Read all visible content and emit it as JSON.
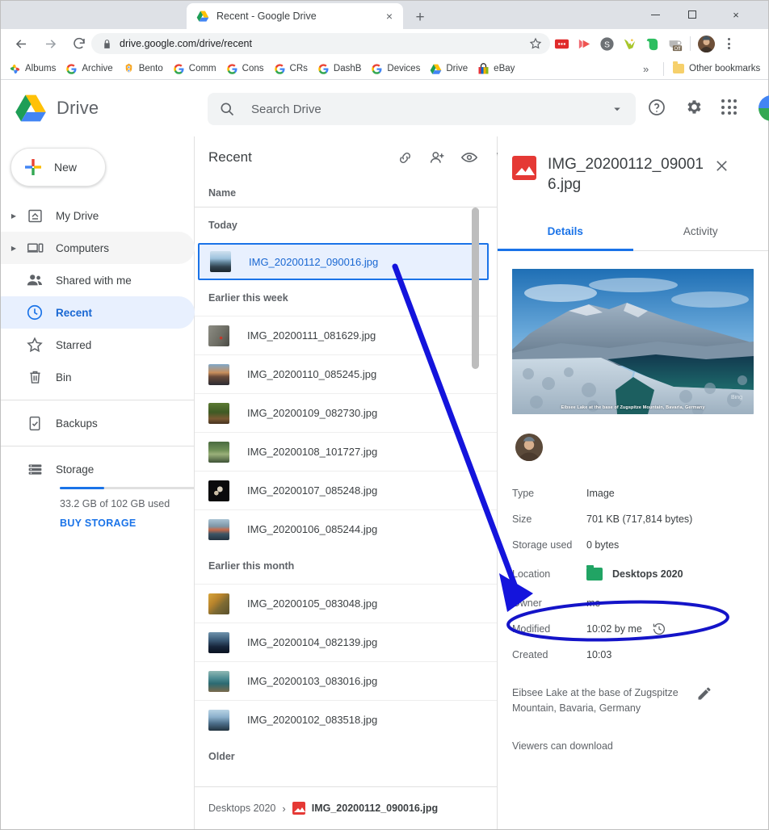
{
  "browser": {
    "tab": {
      "title": "Recent - Google Drive",
      "favicon": "google-drive-icon",
      "close": "×"
    },
    "new_tab_label": "+",
    "window_controls": {
      "minimize": "minimize-icon",
      "maximize": "maximize-icon",
      "close": "×"
    },
    "nav": {
      "back": "←",
      "forward": "→",
      "reload": "↻"
    },
    "omnibox": {
      "url": "drive.google.com/drive/recent",
      "lock": "lock-icon",
      "star": "star-icon"
    },
    "extensions": [
      "red-badge-extension",
      "play-extension",
      "s-circle-extension",
      "bird-extension",
      "evernote-extension",
      "coffee-off-extension"
    ],
    "profile_avatar": "profile-avatar",
    "menu": "three-dot-menu",
    "bookmarks": [
      {
        "label": "Albums",
        "icon": "google-photos-icon"
      },
      {
        "label": "Archive",
        "icon": "google-g-icon"
      },
      {
        "label": "Bento",
        "icon": "bento-icon"
      },
      {
        "label": "Comm",
        "icon": "google-g-icon"
      },
      {
        "label": "Cons",
        "icon": "google-g-icon"
      },
      {
        "label": "CRs",
        "icon": "google-g-icon"
      },
      {
        "label": "DashB",
        "icon": "google-g-icon"
      },
      {
        "label": "Devices",
        "icon": "google-g-icon"
      },
      {
        "label": "Drive",
        "icon": "google-drive-icon"
      },
      {
        "label": "eBay",
        "icon": "ebay-icon"
      }
    ],
    "bookmarks_overflow": "»",
    "other_bookmarks": "Other bookmarks"
  },
  "drive": {
    "app_name": "Drive",
    "search": {
      "placeholder": "Search Drive",
      "icon": "search-icon",
      "caret": "chevron-down-icon"
    },
    "header_icons": [
      "help-icon",
      "settings-gear-icon",
      "apps-grid-icon"
    ],
    "new_button": "New",
    "nav_items": [
      {
        "label": "My Drive",
        "icon": "my-drive-icon",
        "expandable": true,
        "state": ""
      },
      {
        "label": "Computers",
        "icon": "computers-icon",
        "expandable": true,
        "state": "hover"
      },
      {
        "label": "Shared with me",
        "icon": "shared-people-icon",
        "expandable": false,
        "state": ""
      },
      {
        "label": "Recent",
        "icon": "clock-icon",
        "expandable": false,
        "state": "active"
      },
      {
        "label": "Starred",
        "icon": "star-outline-icon",
        "expandable": false,
        "state": ""
      },
      {
        "label": "Bin",
        "icon": "trash-icon",
        "expandable": false,
        "state": ""
      },
      {
        "label": "Backups",
        "icon": "backups-icon",
        "expandable": false,
        "state": ""
      },
      {
        "label": "Storage",
        "icon": "storage-icon",
        "expandable": false,
        "state": ""
      }
    ],
    "storage": {
      "used_text": "33.2 GB of 102 GB used",
      "buy_label": "BUY STORAGE",
      "percent": 33
    }
  },
  "filelist": {
    "title": "Recent",
    "toolbar": [
      "link-icon",
      "add-person-icon",
      "preview-eye-icon",
      "trash-icon",
      "add-to-drive-icon",
      "move-to-folder-icon",
      "more-vert-icon",
      "grid-view-icon",
      "info-icon"
    ],
    "column_header": "Name",
    "groups": [
      {
        "label": "Today",
        "files": [
          {
            "name": "IMG_20200112_090016.jpg",
            "selected": true,
            "thumb": "winter-lake-thumb"
          }
        ]
      },
      {
        "label": "Earlier this week",
        "files": [
          {
            "name": "IMG_20200111_081629.jpg",
            "selected": false,
            "thumb": "pebbles-thumb"
          },
          {
            "name": "IMG_20200110_085245.jpg",
            "selected": false,
            "thumb": "city-dusk-thumb"
          },
          {
            "name": "IMG_20200109_082730.jpg",
            "selected": false,
            "thumb": "forest-path-thumb"
          },
          {
            "name": "IMG_20200108_101727.jpg",
            "selected": false,
            "thumb": "green-park-thumb"
          },
          {
            "name": "IMG_20200107_085248.jpg",
            "selected": false,
            "thumb": "dark-planets-thumb"
          },
          {
            "name": "IMG_20200106_085244.jpg",
            "selected": false,
            "thumb": "harbour-thumb"
          }
        ]
      },
      {
        "label": "Earlier this month",
        "files": [
          {
            "name": "IMG_20200105_083048.jpg",
            "selected": false,
            "thumb": "autumn-thumb"
          },
          {
            "name": "IMG_20200104_082139.jpg",
            "selected": false,
            "thumb": "night-boat-thumb"
          },
          {
            "name": "IMG_20200103_083016.jpg",
            "selected": false,
            "thumb": "turquoise-thumb"
          },
          {
            "name": "IMG_20200102_083518.jpg",
            "selected": false,
            "thumb": "snow-lake-thumb"
          }
        ]
      },
      {
        "label": "Older",
        "files": []
      }
    ],
    "breadcrumb": {
      "folder": "Desktops 2020",
      "separator": "›",
      "file": "IMG_20200112_090016.jpg",
      "file_icon": "image-file-icon"
    }
  },
  "details": {
    "file_icon": "image-file-icon",
    "file_name": "IMG_20200112_090016.jpg",
    "close": "✕",
    "tabs": [
      {
        "label": "Details",
        "active": true
      },
      {
        "label": "Activity",
        "active": false
      }
    ],
    "preview": {
      "caption": "Eibsee Lake at the base of Zugspitze Mountain, Bavaria, Germany",
      "watermark": "Bing"
    },
    "owner_avatar": "owner-avatar",
    "meta": [
      {
        "label": "Type",
        "value": "Image"
      },
      {
        "label": "Size",
        "value": "701 KB (717,814 bytes)"
      },
      {
        "label": "Storage used",
        "value": "0 bytes"
      },
      {
        "label": "Location",
        "value": "Desktops 2020",
        "folder_icon": "green-folder-icon",
        "highlighted": true
      },
      {
        "label": "Owner",
        "value": "me"
      },
      {
        "label": "Modified",
        "value": "10:02 by me",
        "extra_icon": "version-history-icon"
      },
      {
        "label": "Created",
        "value": "10:03"
      }
    ],
    "description": "Eibsee Lake at the base of Zugspitze Mountain, Bavaria, Germany",
    "edit_icon": "pencil-icon",
    "viewers_note": "Viewers can download"
  },
  "annotation": {
    "arrow_color": "#1414dc",
    "ellipse_color": "#1414c8"
  }
}
